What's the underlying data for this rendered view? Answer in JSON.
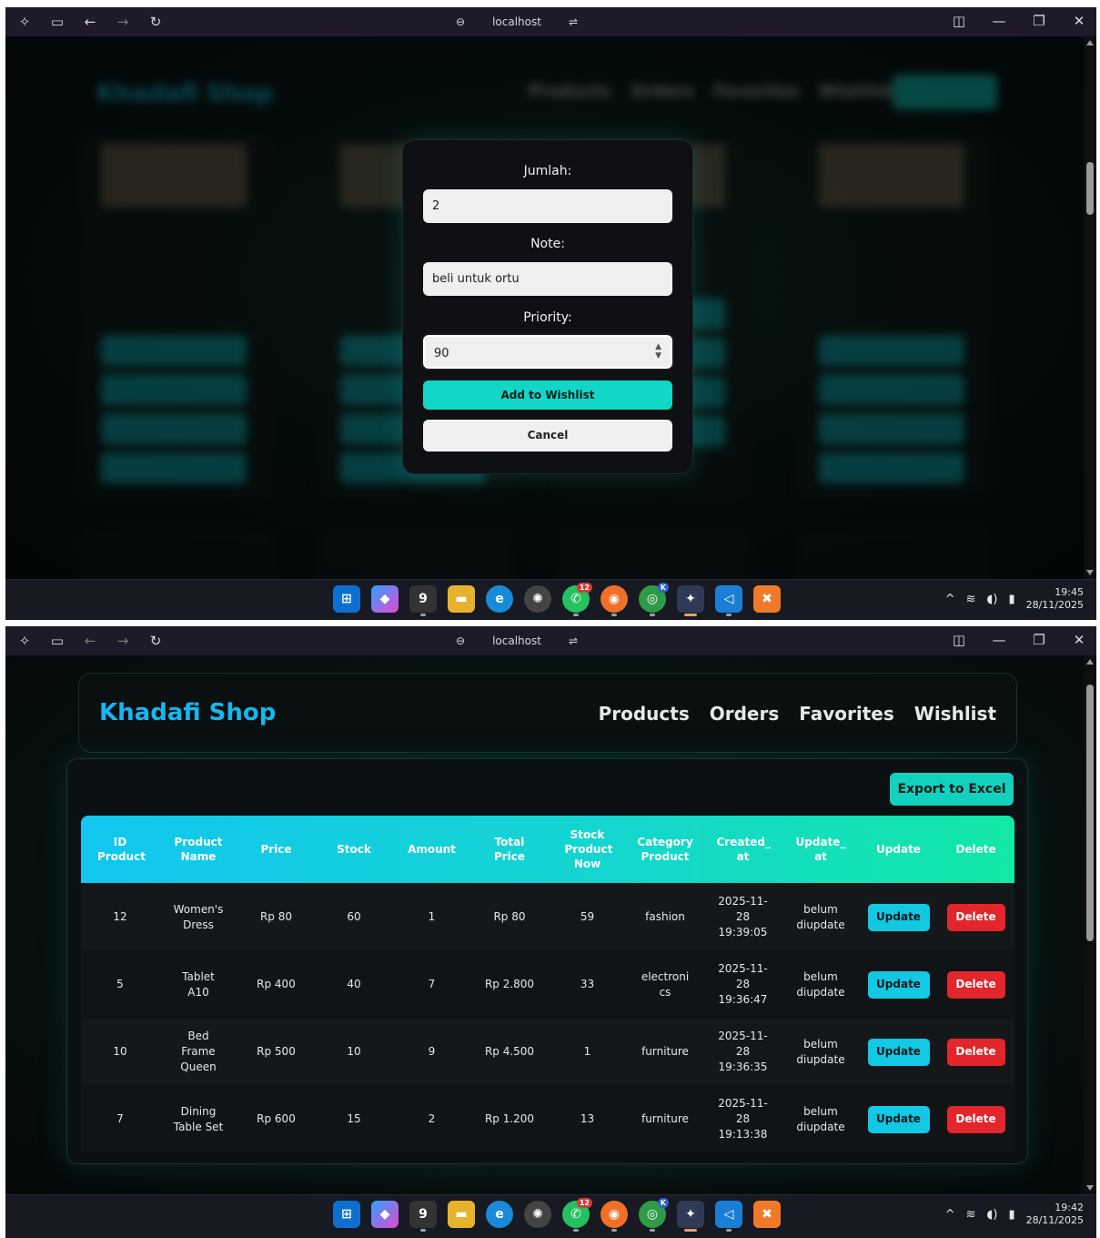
{
  "browser": {
    "address": "localhost"
  },
  "taskbar": {
    "badge": "12",
    "k_badge": "K",
    "g_label": "9",
    "shot1_time": "19:45",
    "shot1_date": "28/11/2025",
    "shot2_time": "19:42",
    "shot2_date": "28/11/2025"
  },
  "modal": {
    "jumlah_label": "Jumlah:",
    "jumlah_value": "2",
    "note_label": "Note:",
    "note_value": "beli untuk ortu",
    "priority_label": "Priority:",
    "priority_value": "90",
    "add_label": "Add to Wishlist",
    "cancel_label": "Cancel"
  },
  "background": {
    "brand": "Khadafi Shop",
    "nav": [
      "Products",
      "Orders",
      "Favorites",
      "Wishlist"
    ]
  },
  "page": {
    "brand": "Khadafi Shop",
    "nav": [
      "Products",
      "Orders",
      "Favorites",
      "Wishlist"
    ],
    "export_label": "Export to Excel",
    "columns": [
      "ID Product",
      "Product Name",
      "Price",
      "Stock",
      "Amount",
      "Total Price",
      "Stock Product Now",
      "Category Product",
      "Created_ at",
      "Update_ at",
      "Update",
      "Delete"
    ],
    "rows": [
      {
        "id": "12",
        "name": "Women's Dress",
        "price": "Rp 80",
        "stock": "60",
        "amount": "1",
        "total": "Rp 80",
        "stock_now": "59",
        "category": "fashion",
        "created": "2025-11-28 19:39:05",
        "updated": "belum diupdate",
        "update_btn": "Update",
        "delete_btn": "Delete"
      },
      {
        "id": "5",
        "name": "Tablet A10",
        "price": "Rp 400",
        "stock": "40",
        "amount": "7",
        "total": "Rp 2.800",
        "stock_now": "33",
        "category": "electronics",
        "created": "2025-11-28 19:36:47",
        "updated": "belum diupdate",
        "update_btn": "Update",
        "delete_btn": "Delete"
      },
      {
        "id": "10",
        "name": "Bed Frame Queen",
        "price": "Rp 500",
        "stock": "10",
        "amount": "9",
        "total": "Rp 4.500",
        "stock_now": "1",
        "category": "furniture",
        "created": "2025-11-28 19:36:35",
        "updated": "belum diupdate",
        "update_btn": "Update",
        "delete_btn": "Delete"
      },
      {
        "id": "7",
        "name": "Dining Table Set",
        "price": "Rp 600",
        "stock": "15",
        "amount": "2",
        "total": "Rp 1.200",
        "stock_now": "13",
        "category": "furniture",
        "created": "2025-11-28 19:13:38",
        "updated": "belum diupdate",
        "update_btn": "Update",
        "delete_btn": "Delete"
      }
    ]
  },
  "icons": [
    "sparkle-icon",
    "sidebar-icon",
    "back-icon",
    "forward-icon",
    "refresh-icon",
    "link-icon",
    "tune-icon",
    "split-icon",
    "minimize-icon",
    "restore-icon",
    "close-icon",
    "windows-start-icon",
    "copilot-icon",
    "file-explorer-icon",
    "edge-icon",
    "chatgpt-icon",
    "whatsapp-icon",
    "firefox-icon",
    "chrome-icon",
    "vscode-icon",
    "xampp-icon",
    "wifi-icon",
    "volume-icon",
    "battery-icon"
  ],
  "colors": {
    "accent_cyan": "#17b6ef",
    "accent_teal": "#12d7c6",
    "delete_red": "#e2262b"
  }
}
